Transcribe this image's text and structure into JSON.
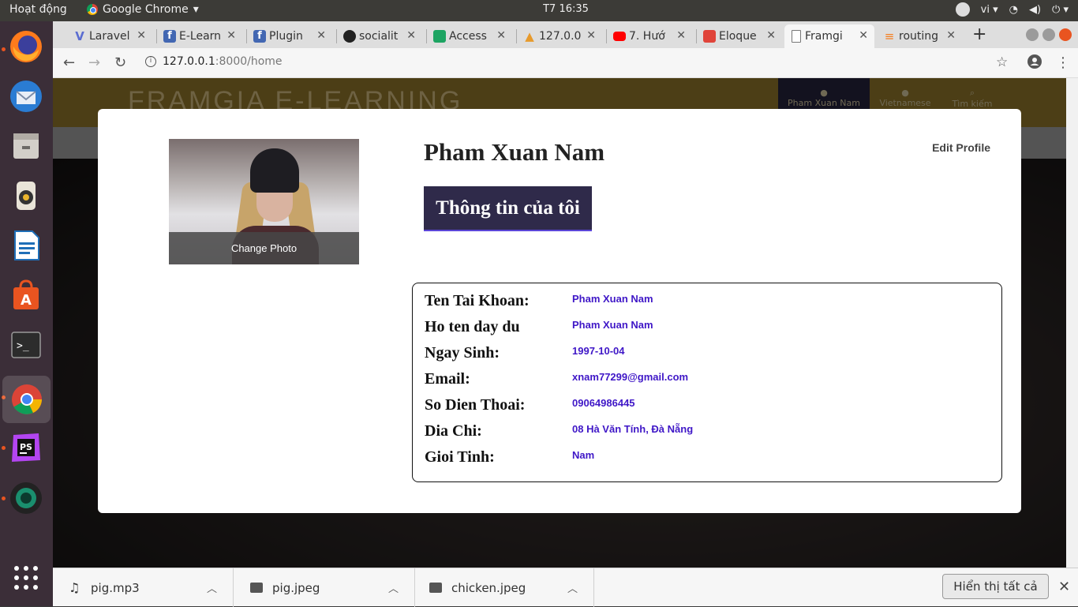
{
  "system_bar": {
    "activities": "Hoạt động",
    "app_name": "Google Chrome",
    "clock": "T7 16:35",
    "language": "vi"
  },
  "browser": {
    "tabs": [
      {
        "label": "Laravel",
        "favicon_color": "#5b6dd1"
      },
      {
        "label": "E-Learn",
        "favicon_color": "#4267b2"
      },
      {
        "label": "Plugin",
        "favicon_color": "#4267b2"
      },
      {
        "label": "socialit",
        "favicon_color": "#222222"
      },
      {
        "label": "Access",
        "favicon_color": "#1da462"
      },
      {
        "label": "127.0.0",
        "favicon_color": "#e79a2c"
      },
      {
        "label": "7. Hướ",
        "favicon_color": "#ff0000"
      },
      {
        "label": "Eloque",
        "favicon_color": "#e0443a"
      },
      {
        "label": "Framgi",
        "favicon_color": "#777777"
      },
      {
        "label": "routing",
        "favicon_color": "#f48024"
      }
    ],
    "active_tab_index": 8,
    "url_host": "127.0.0.1",
    "url_path": ":8000/home"
  },
  "site": {
    "logo": "FRAMGIA E-LEARNING",
    "nav": [
      "Pham Xuan Nam",
      "Vietnamese",
      "Tìm kiếm"
    ]
  },
  "profile": {
    "name": "Pham Xuan Nam",
    "edit_label": "Edit Profile",
    "change_photo": "Change Photo",
    "myinfo_button": "Thông tin của tôi",
    "fields": [
      {
        "label": "Ten Tai Khoan:",
        "value": "Pham Xuan Nam"
      },
      {
        "label": "Ho ten day du",
        "value": "Pham Xuan Nam"
      },
      {
        "label": "Ngay Sinh:",
        "value": "1997-10-04"
      },
      {
        "label": "Email:",
        "value": "xnam77299@gmail.com"
      },
      {
        "label": "So Dien Thoai:",
        "value": "09064986445"
      },
      {
        "label": "Dia Chi:",
        "value": "08 Hà Văn Tính, Đà Nẵng"
      },
      {
        "label": "Gioi Tinh:",
        "value": "Nam"
      }
    ]
  },
  "downloads": {
    "items": [
      "pig.mp3",
      "pig.jpeg",
      "chicken.jpeg"
    ],
    "show_all": "Hiển thị tất cả"
  }
}
